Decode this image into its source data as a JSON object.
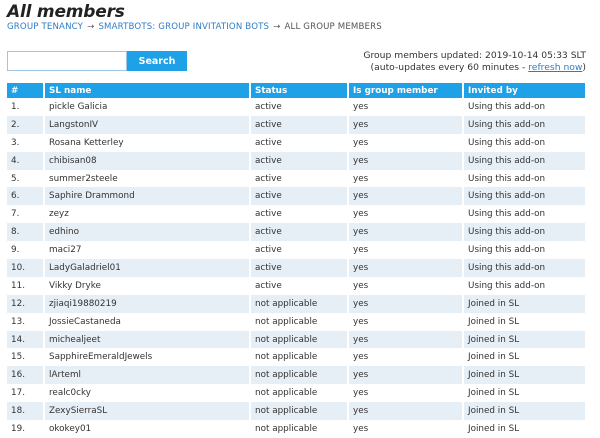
{
  "page": {
    "title": "All members",
    "breadcrumb": [
      {
        "label": "GROUP TENANCY",
        "link": true
      },
      {
        "label": "SMARTBOTS: GROUP INVITATION BOTS",
        "link": true
      },
      {
        "label": "ALL GROUP MEMBERS",
        "link": false
      }
    ],
    "breadcrumb_separator": "→"
  },
  "search": {
    "value": "",
    "placeholder": "",
    "button_label": "Search"
  },
  "update_info": {
    "line1": "Group members updated: 2019-10-14 05:33 SLT",
    "line2_prefix": "(auto-updates every 60 minutes - ",
    "refresh_label": "refresh now",
    "line2_suffix": ")"
  },
  "colors": {
    "accent": "#1ea1e6",
    "link": "#2e7cc4",
    "row_alt": "#e6eef6"
  },
  "table": {
    "headers": [
      "#",
      "SL name",
      "Status",
      "Is group member",
      "Invited by"
    ],
    "rows": [
      [
        "1.",
        "pickle Galicia",
        "active",
        "yes",
        "Using this add-on"
      ],
      [
        "2.",
        "LangstonIV",
        "active",
        "yes",
        "Using this add-on"
      ],
      [
        "3.",
        "Rosana Ketterley",
        "active",
        "yes",
        "Using this add-on"
      ],
      [
        "4.",
        "chibisan08",
        "active",
        "yes",
        "Using this add-on"
      ],
      [
        "5.",
        "summer2steele",
        "active",
        "yes",
        "Using this add-on"
      ],
      [
        "6.",
        "Saphire Drammond",
        "active",
        "yes",
        "Using this add-on"
      ],
      [
        "7.",
        "zeyz",
        "active",
        "yes",
        "Using this add-on"
      ],
      [
        "8.",
        "edhino",
        "active",
        "yes",
        "Using this add-on"
      ],
      [
        "9.",
        "maci27",
        "active",
        "yes",
        "Using this add-on"
      ],
      [
        "10.",
        "LadyGaladriel01",
        "active",
        "yes",
        "Using this add-on"
      ],
      [
        "11.",
        "Vikky Dryke",
        "active",
        "yes",
        "Using this add-on"
      ],
      [
        "12.",
        "zjiaqi19880219",
        "not applicable",
        "yes",
        "Joined in SL"
      ],
      [
        "13.",
        "JossieCastaneda",
        "not applicable",
        "yes",
        "Joined in SL"
      ],
      [
        "14.",
        "michealjeet",
        "not applicable",
        "yes",
        "Joined in SL"
      ],
      [
        "15.",
        "SapphireEmeraldJewels",
        "not applicable",
        "yes",
        "Joined in SL"
      ],
      [
        "16.",
        "lArteml",
        "not applicable",
        "yes",
        "Joined in SL"
      ],
      [
        "17.",
        "realc0cky",
        "not applicable",
        "yes",
        "Joined in SL"
      ],
      [
        "18.",
        "ZexySierraSL",
        "not applicable",
        "yes",
        "Joined in SL"
      ],
      [
        "19.",
        "okokey01",
        "not applicable",
        "yes",
        "Joined in SL"
      ]
    ]
  }
}
